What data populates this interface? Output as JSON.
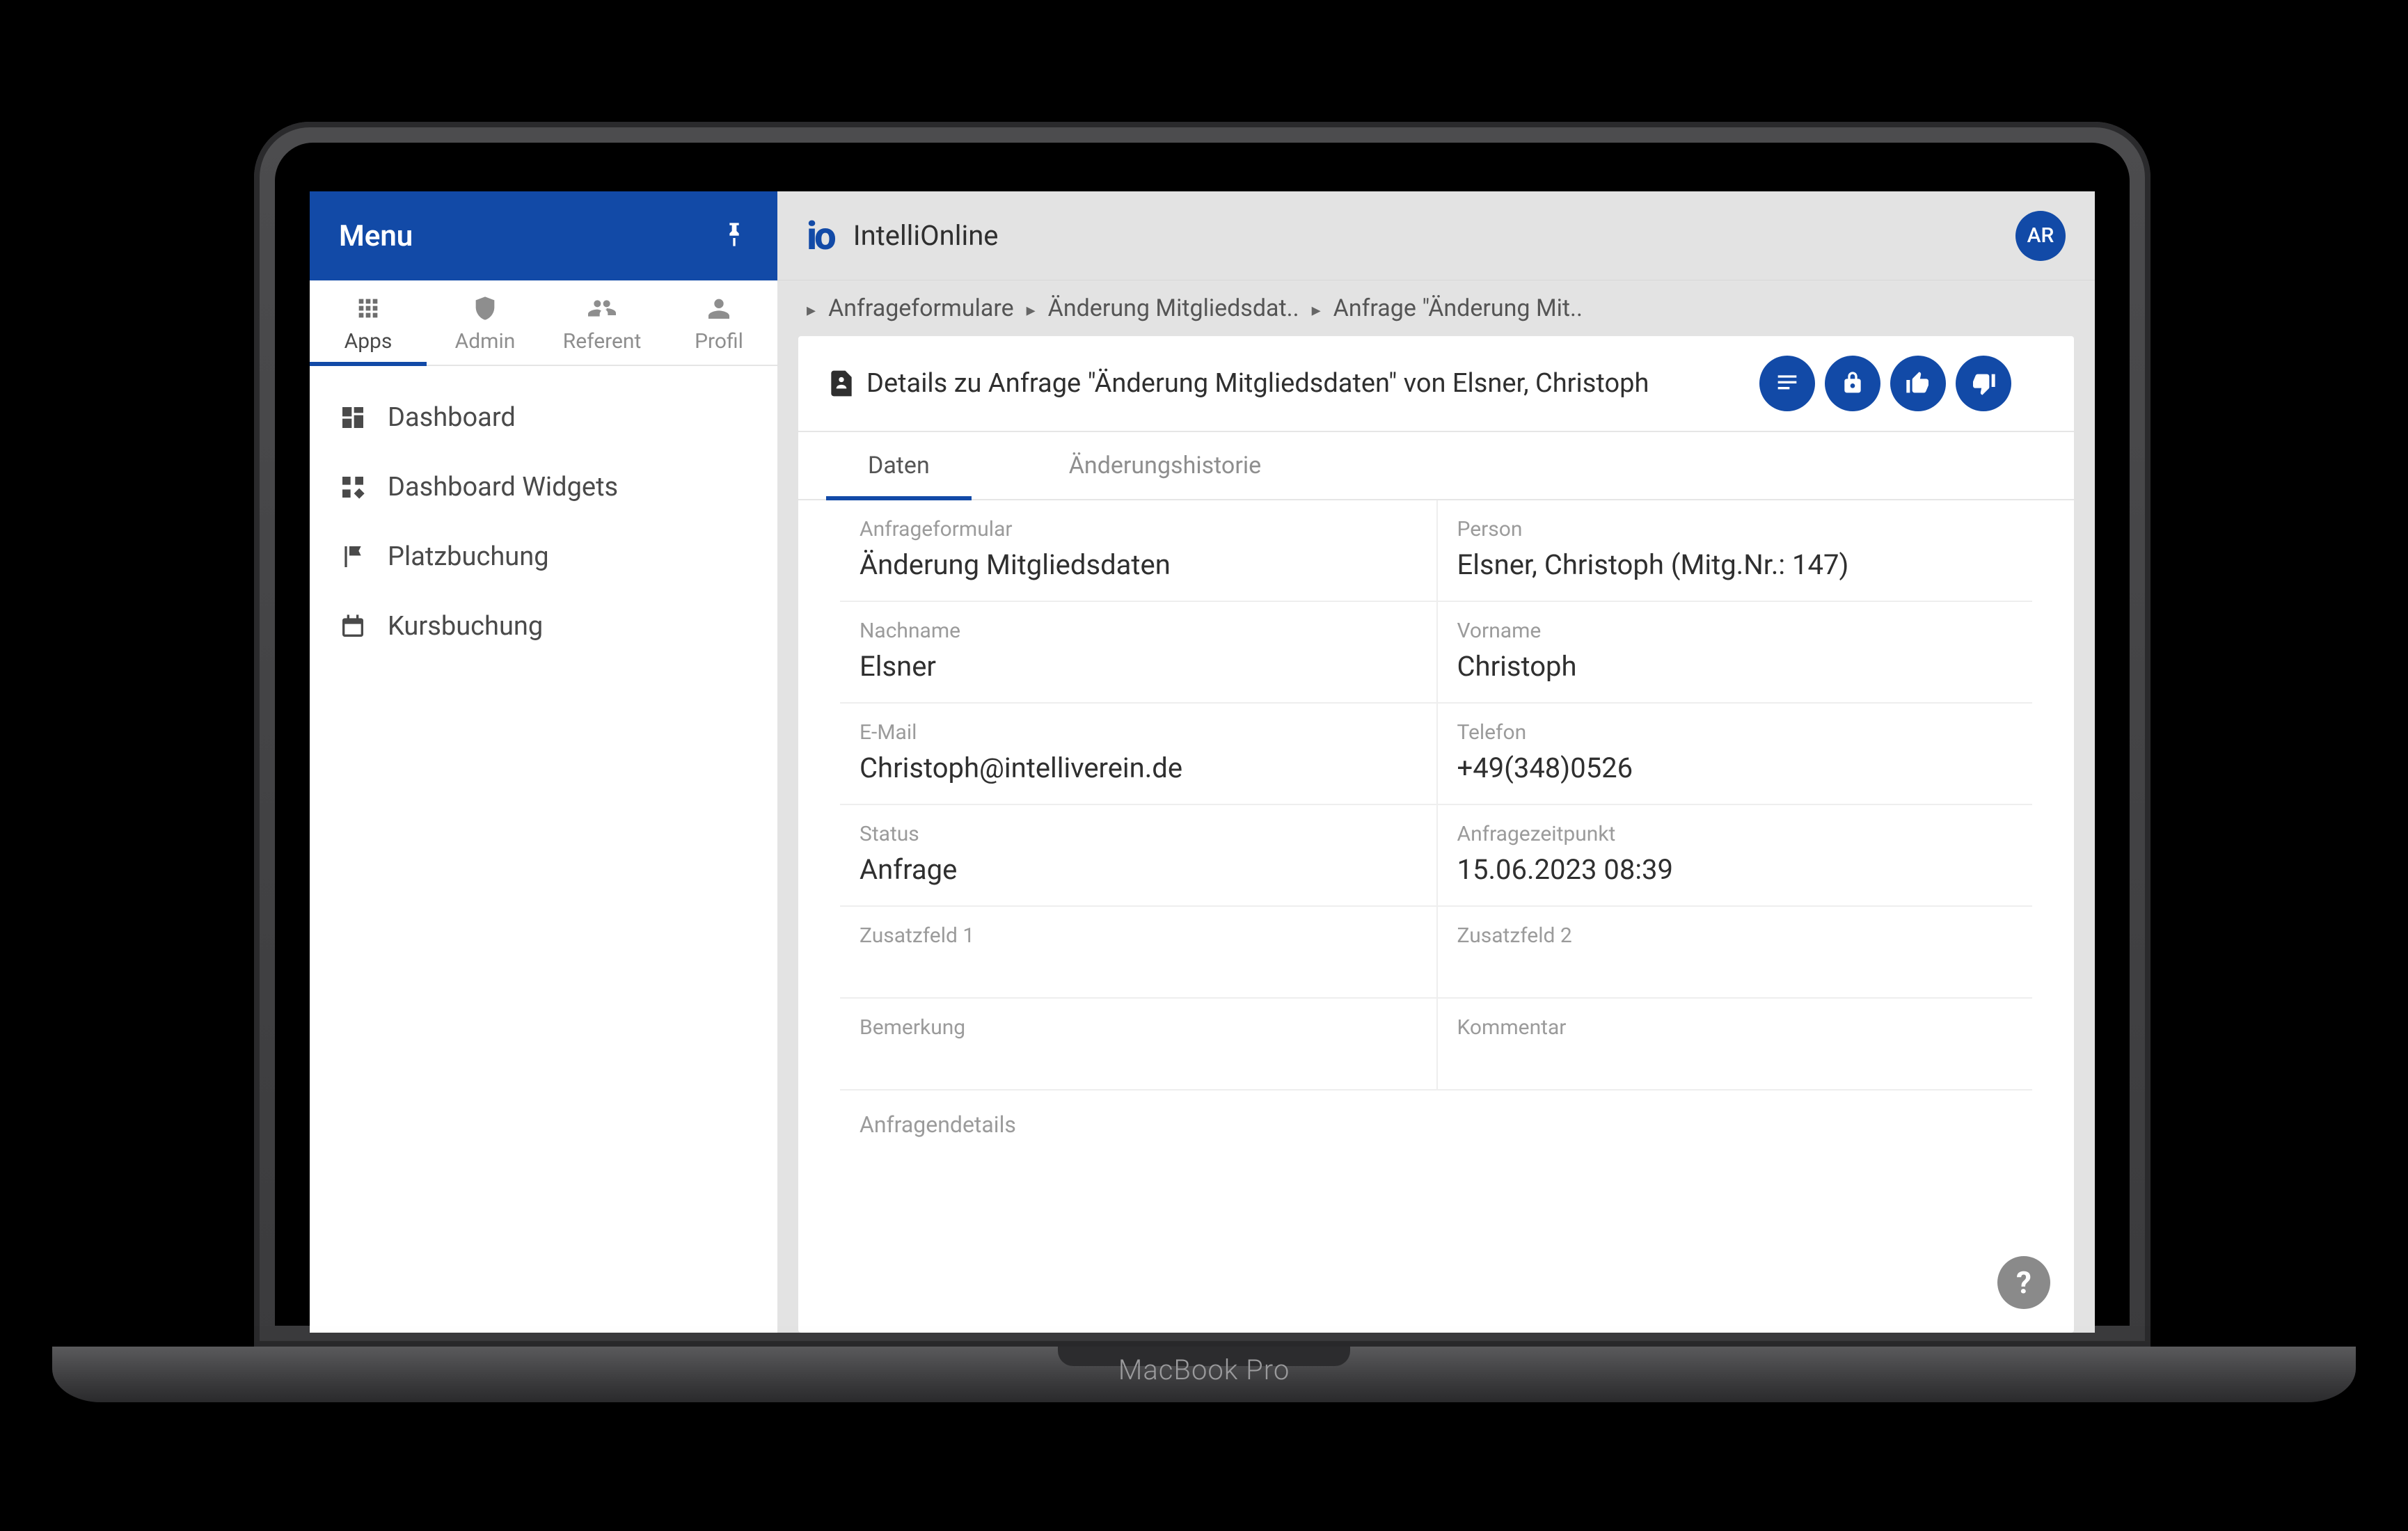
{
  "device_label": "MacBook Pro",
  "sidebar": {
    "menu_label": "Menu",
    "tabs": [
      {
        "label": "Apps"
      },
      {
        "label": "Admin"
      },
      {
        "label": "Referent"
      },
      {
        "label": "Profil"
      }
    ],
    "nav": [
      {
        "label": "Dashboard"
      },
      {
        "label": "Dashboard Widgets"
      },
      {
        "label": "Platzbuchung"
      },
      {
        "label": "Kursbuchung"
      }
    ]
  },
  "header": {
    "app_name": "IntelliOnline",
    "avatar_initials": "AR"
  },
  "breadcrumb": [
    "Anfrageformulare",
    "Änderung Mitgliedsdat..",
    "Anfrage \"Änderung Mit.."
  ],
  "detail": {
    "title": "Details zu Anfrage \"Änderung Mitgliedsdaten\" von Elsner, Christoph",
    "tabs": [
      "Daten",
      "Änderungshistorie"
    ],
    "fields": {
      "anfrageformular": {
        "label": "Anfrageformular",
        "value": "Änderung Mitgliedsdaten"
      },
      "person": {
        "label": "Person",
        "value": "Elsner, Christoph (Mitg.Nr.: 147)"
      },
      "nachname": {
        "label": "Nachname",
        "value": "Elsner"
      },
      "vorname": {
        "label": "Vorname",
        "value": "Christoph"
      },
      "email": {
        "label": "E-Mail",
        "value": "Christoph@intelliverein.de"
      },
      "telefon": {
        "label": "Telefon",
        "value": "+49(348)0526"
      },
      "status": {
        "label": "Status",
        "value": "Anfrage"
      },
      "anfragezeitpunkt": {
        "label": "Anfragezeitpunkt",
        "value": "15.06.2023 08:39"
      },
      "zusatz1": {
        "label": "Zusatzfeld 1",
        "value": ""
      },
      "zusatz2": {
        "label": "Zusatzfeld 2",
        "value": ""
      },
      "bemerkung": {
        "label": "Bemerkung",
        "value": ""
      },
      "kommentar": {
        "label": "Kommentar",
        "value": ""
      }
    },
    "section_header": "Anfragendetails"
  },
  "help": "?"
}
